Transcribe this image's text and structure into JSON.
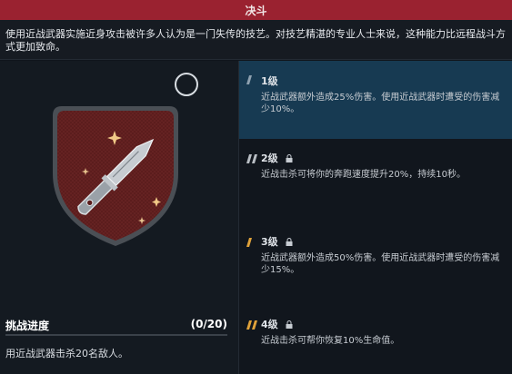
{
  "header": {
    "title": "决斗"
  },
  "description": "使用近战武器实施近身攻击被许多人认为是一门失传的技艺。对技艺精湛的专业人士来说，这种能力比远程战斗方式更加致命。",
  "challenge": {
    "title": "挑战进度",
    "count": "(0/20)",
    "progress_fraction": 0,
    "text": "用近战武器击杀20名敌人。"
  },
  "tiers": [
    {
      "label": "1级",
      "text": "近战武器额外造成25%伤害。使用近战武器时遭受的伤害减少10%。",
      "locked": false,
      "color": "#8fa1b0"
    },
    {
      "label": "2级",
      "text": "近战击杀可将你的奔跑速度提升20%，持续10秒。",
      "locked": true,
      "color": "#b9bec4"
    },
    {
      "label": "3级",
      "text": "近战武器额外造成50%伤害。使用近战武器时遭受的伤害减少15%。",
      "locked": true,
      "color": "#e0a23a"
    },
    {
      "label": "4级",
      "text": "近战击杀可帮你恢复10%生命值。",
      "locked": true,
      "color": "#e0a23a"
    }
  ],
  "colors": {
    "accent_red": "#9a2230",
    "active_tier": "#173a52",
    "gold": "#e0a23a"
  }
}
